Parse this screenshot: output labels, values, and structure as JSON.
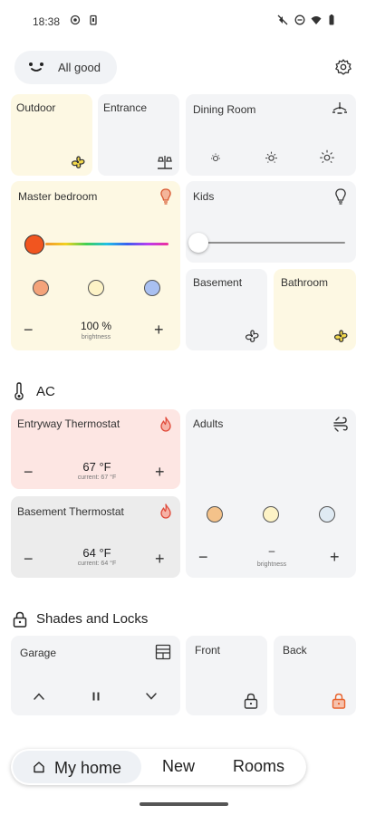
{
  "status_bar": {
    "time": "18:38"
  },
  "header": {
    "status_text": "All good"
  },
  "tiles": {
    "outdoor": {
      "label": "Outdoor"
    },
    "entrance": {
      "label": "Entrance"
    },
    "dining_room": {
      "label": "Dining Room"
    },
    "master_bedroom": {
      "label": "Master bedroom",
      "brightness_value": "100 %",
      "brightness_label": "brightness",
      "minus": "−",
      "plus": "+",
      "colors": [
        "#f4a37a",
        "#fdf3c6",
        "#a9c0f1"
      ],
      "slider_color": "#f1551f"
    },
    "kids": {
      "label": "Kids"
    },
    "basement": {
      "label": "Basement"
    },
    "bathroom": {
      "label": "Bathroom"
    }
  },
  "ac_section": {
    "title": "AC"
  },
  "thermostats": {
    "entryway": {
      "label": "Entryway Thermostat",
      "value": "67 °F",
      "current": "current: 67 °F",
      "minus": "−",
      "plus": "+"
    },
    "basement": {
      "label": "Basement Thermostat",
      "value": "64 °F",
      "current": "current: 64 °F",
      "minus": "−",
      "plus": "+"
    },
    "adults": {
      "label": "Adults",
      "value": "–",
      "brightness_label": "brightness",
      "minus": "−",
      "plus": "+",
      "colors": [
        "#f4c28a",
        "#fdf3c6",
        "#dfeaf3"
      ]
    }
  },
  "shades_section": {
    "title": "Shades and Locks"
  },
  "shades": {
    "garage": {
      "label": "Garage"
    },
    "front": {
      "label": "Front"
    },
    "back": {
      "label": "Back"
    }
  },
  "nav": {
    "items": [
      "My home",
      "New",
      "Rooms"
    ]
  },
  "colors": {
    "warm_tile": "#fdf8e3",
    "red_tile": "#fde6e3",
    "accent_orange": "#e8612b",
    "flame_red": "#e04a3a"
  }
}
